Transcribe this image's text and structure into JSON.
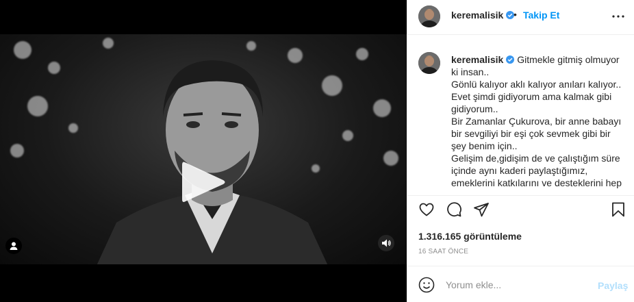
{
  "post": {
    "username": "keremalisik",
    "follow_label": "Takip Et",
    "dot": "•"
  },
  "caption": {
    "username": "keremalisik",
    "lines": [
      "Gitmekle gitmiş olmuyor ki insan..",
      "Gönlü kalıyor aklı kalıyor anıları kalıyor..",
      "Evet şimdi gidiyorum ama kalmak gibi gidiyorum..",
      "Bir Zamanlar Çukurova, bir anne babayı bir sevgiliyi bir eşi çok sevmek gibi bir şey benim için..",
      "Gelişim de,gidişim de ve çalıştığım süre içinde aynı kaderi paylaştığımız, emeklerini katkılarını ve desteklerini hep"
    ]
  },
  "stats": {
    "views": "1.316.165 görüntüleme",
    "time": "16 SAAT ÖNCE"
  },
  "comment_box": {
    "placeholder": "Yorum ekle...",
    "post_label": "Paylaş"
  },
  "colors": {
    "link_blue": "#0095f6",
    "verified_blue": "#3897f0",
    "muted": "#8e8e8e",
    "post_disabled": "#b2dffc"
  },
  "icons": {
    "play": "play-icon",
    "user_tag": "user-tag-icon",
    "volume": "volume-icon",
    "more": "more-options-icon",
    "like": "heart-icon",
    "comment": "comment-icon",
    "share": "share-icon",
    "save": "bookmark-icon",
    "emoji": "emoji-icon"
  }
}
